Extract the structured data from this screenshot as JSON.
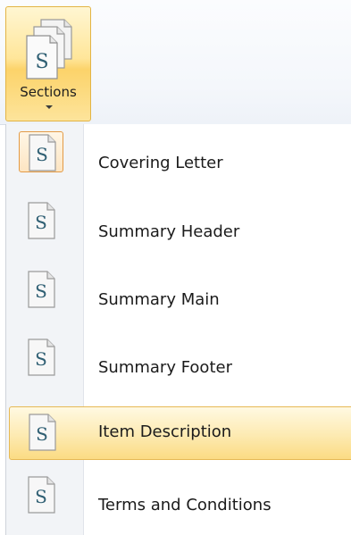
{
  "ribbon": {
    "sections_button": {
      "label": "Sections",
      "icon": "stacked-section-documents-icon"
    }
  },
  "menu": {
    "item_icon_letter": "S",
    "items": [
      {
        "label": "Covering Letter",
        "icon": "section-document-icon",
        "state": "checked"
      },
      {
        "label": "Summary Header",
        "icon": "section-document-icon",
        "state": "normal"
      },
      {
        "label": "Summary Main",
        "icon": "section-document-icon",
        "state": "normal"
      },
      {
        "label": "Summary Footer",
        "icon": "section-document-icon",
        "state": "normal"
      },
      {
        "label": "Item Description",
        "icon": "section-document-icon",
        "state": "hover"
      },
      {
        "label": "Terms and Conditions",
        "icon": "section-document-icon",
        "state": "normal"
      }
    ]
  },
  "colors": {
    "highlight_border": "#e6b955",
    "checked_border": "#e39a45",
    "icon_letter": "#2f5f73"
  }
}
